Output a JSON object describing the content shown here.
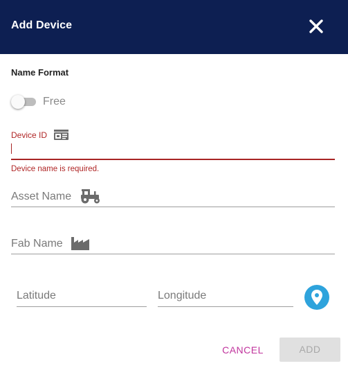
{
  "dialog": {
    "title": "Add Device",
    "header_color": "#0d1f52"
  },
  "name_format": {
    "label": "Name Format",
    "toggle_label": "Free",
    "toggle_on": false
  },
  "device_id": {
    "label": "Device ID",
    "value": "",
    "error": "Device name is required.",
    "icon": "id-card-icon"
  },
  "asset_name": {
    "placeholder": "Asset Name",
    "icon": "tractor-icon"
  },
  "fab_name": {
    "placeholder": "Fab Name",
    "icon": "factory-icon"
  },
  "latitude": {
    "placeholder": "Latitude"
  },
  "longitude": {
    "placeholder": "Longitude"
  },
  "location_button": {
    "icon": "location-pin-icon",
    "color": "#2ea3dc"
  },
  "actions": {
    "cancel_label": "CANCEL",
    "add_label": "ADD",
    "cancel_color": "#c0349d"
  },
  "colors": {
    "error": "#b02626"
  }
}
